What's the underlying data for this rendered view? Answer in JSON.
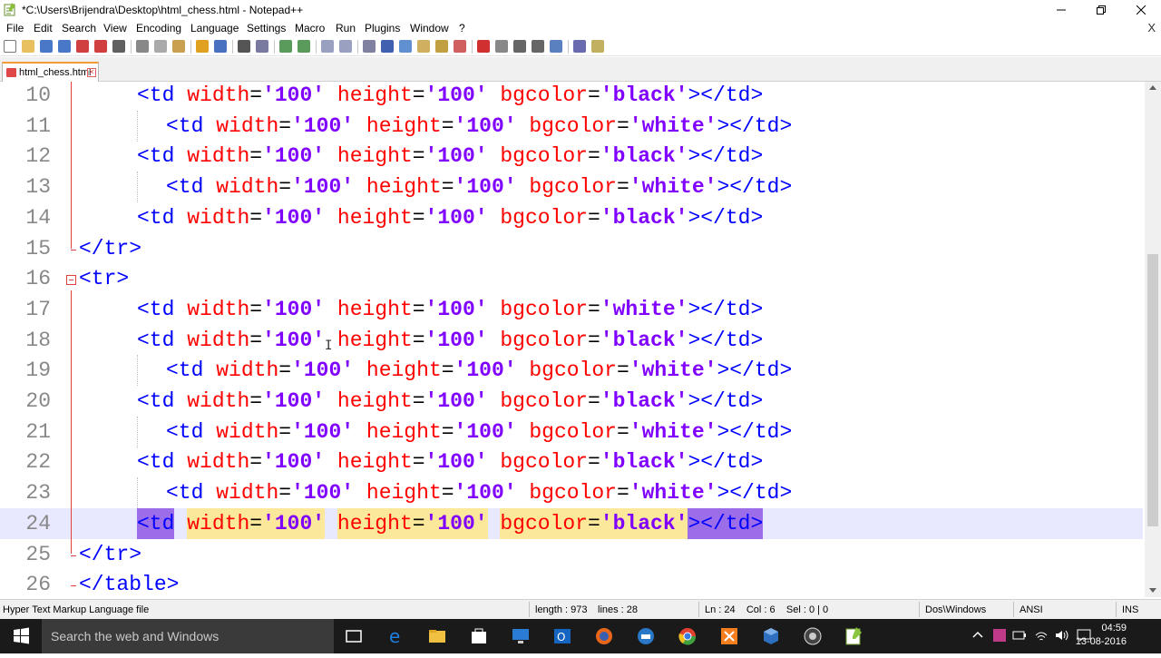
{
  "window": {
    "title": "*C:\\Users\\Brijendra\\Desktop\\html_chess.html - Notepad++",
    "close_doc_glyph": "X"
  },
  "menu": [
    "File",
    "Edit",
    "Search",
    "View",
    "Encoding",
    "Language",
    "Settings",
    "Macro",
    "Run",
    "Plugins",
    "Window",
    "?"
  ],
  "tab": {
    "label": "html_chess.html"
  },
  "editor": {
    "lines": [
      {
        "num": "10",
        "indent": 2,
        "kind": "td",
        "color": "black"
      },
      {
        "num": "11",
        "indent": 3,
        "kind": "td",
        "color": "white"
      },
      {
        "num": "12",
        "indent": 2,
        "kind": "td",
        "color": "black"
      },
      {
        "num": "13",
        "indent": 3,
        "kind": "td",
        "color": "white"
      },
      {
        "num": "14",
        "indent": 2,
        "kind": "td",
        "color": "black"
      },
      {
        "num": "15",
        "indent": 0,
        "kind": "raw",
        "text": "</tr>"
      },
      {
        "num": "16",
        "indent": 0,
        "kind": "raw",
        "text": "<tr>"
      },
      {
        "num": "17",
        "indent": 2,
        "kind": "td",
        "color": "white"
      },
      {
        "num": "18",
        "indent": 2,
        "kind": "td",
        "color": "black"
      },
      {
        "num": "19",
        "indent": 3,
        "kind": "td",
        "color": "white"
      },
      {
        "num": "20",
        "indent": 2,
        "kind": "td",
        "color": "black"
      },
      {
        "num": "21",
        "indent": 3,
        "kind": "td",
        "color": "white"
      },
      {
        "num": "22",
        "indent": 2,
        "kind": "td",
        "color": "black"
      },
      {
        "num": "23",
        "indent": 3,
        "kind": "td",
        "color": "white"
      },
      {
        "num": "24",
        "indent": 2,
        "kind": "td",
        "color": "black",
        "current": true
      },
      {
        "num": "25",
        "indent": 0,
        "kind": "raw",
        "text": "</tr>"
      },
      {
        "num": "26",
        "indent": 0,
        "kind": "raw",
        "text": "</table>"
      }
    ],
    "attr_width": "width",
    "attr_height": "height",
    "attr_bgcolor": "bgcolor",
    "value_100": "'100'",
    "open_tag": "<td",
    "close_tag": "></td>"
  },
  "status": {
    "file_type": "Hyper Text Markup Language file",
    "length": "length : 973",
    "lines": "lines : 28",
    "position": "Ln : 24    Col : 6    Sel : 0 | 0",
    "eol": "Dos\\Windows",
    "encoding": "ANSI",
    "mode": "INS"
  },
  "taskbar": {
    "search_placeholder": "Search the web and Windows",
    "time": "04:59",
    "date": "13-08-2016"
  },
  "colors": {
    "tag": "#0000ff",
    "attribute": "#ff0000",
    "value": "#8000ff",
    "current_line": "#e8e8ff",
    "tab_accent": "#f29c38"
  }
}
